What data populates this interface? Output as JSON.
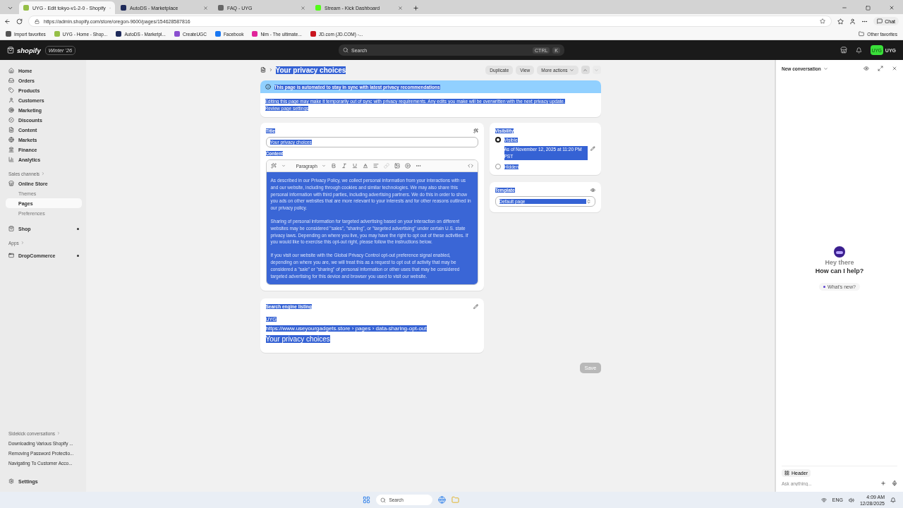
{
  "browser": {
    "tabs": [
      {
        "label": "UYG - Edit tokyo-v1-2-0 - Shopify",
        "selected": true,
        "color": "#95bf47"
      },
      {
        "label": "AutoDS - Marketplace",
        "selected": false,
        "color": "#1e2a5a"
      },
      {
        "label": "FAQ - UYG",
        "selected": false,
        "color": "#666666"
      },
      {
        "label": "Stream - Kick Dashboard",
        "selected": false,
        "color": "#53fc18"
      }
    ],
    "url": "https://admin.shopify.com/store/oregon-9600/pages/154628587816",
    "chat_button": "Chat",
    "bookmarks": [
      {
        "label": "Import favorites",
        "color": "#555555"
      },
      {
        "label": "UYG - Home - Shop...",
        "color": "#95bf47"
      },
      {
        "label": "AutoDS - Marketpl...",
        "color": "#1e2a5a"
      },
      {
        "label": "CreateUGC",
        "color": "#8a4fcf"
      },
      {
        "label": "Facebook",
        "color": "#1877f2"
      },
      {
        "label": "Nim - The ultimate...",
        "color": "#e0249a"
      },
      {
        "label": "JD.com (JD.COM) -...",
        "color": "#c9151e"
      }
    ],
    "other_favorites": "Other favorites"
  },
  "topbar": {
    "logo": "shopify",
    "edition": "Winter '26",
    "search_placeholder": "Search",
    "shortcut": [
      "CTRL",
      "K"
    ],
    "store_initials": "UYG",
    "store_name": "UYG"
  },
  "sidebar": {
    "items": [
      {
        "label": "Home",
        "selected": false
      },
      {
        "label": "Orders",
        "selected": false
      },
      {
        "label": "Products",
        "selected": false
      },
      {
        "label": "Customers",
        "selected": false
      },
      {
        "label": "Marketing",
        "selected": false
      },
      {
        "label": "Discounts",
        "selected": false
      },
      {
        "label": "Content",
        "selected": false
      },
      {
        "label": "Markets",
        "selected": false
      },
      {
        "label": "Finance",
        "selected": false
      },
      {
        "label": "Analytics",
        "selected": false
      }
    ],
    "sales_channels_label": "Sales channels",
    "channels": [
      {
        "label": "Online Store",
        "dot": false,
        "children": [
          {
            "label": "Themes",
            "selected": false
          },
          {
            "label": "Pages",
            "selected": true
          },
          {
            "label": "Preferences",
            "selected": false
          }
        ]
      },
      {
        "label": "Shop",
        "dot": true
      }
    ],
    "apps_label": "Apps",
    "apps": [
      {
        "label": "DropCommerce",
        "dot": true
      }
    ],
    "conversations_label": "Sidekick conversations",
    "conversations": [
      "Downloading Various Shopify ...",
      "Removing Password Protectio...",
      "Navigating To Customer Acco..."
    ],
    "settings": "Settings"
  },
  "page": {
    "text_selected": true,
    "title": "Your privacy choices",
    "actions": [
      "Duplicate",
      "View",
      "More actions"
    ],
    "nav": [
      {
        "disabled": false
      },
      {
        "disabled": true
      }
    ],
    "banner": {
      "title": "This page is automated to stay in sync with latest privacy recommendations",
      "body": "Editing this page may make it temporarily out of sync with privacy requirements. Any edits you make will be overwritten with the next privacy update.",
      "link": "Review page settings"
    },
    "title_field": {
      "label": "Title",
      "value": "Your privacy choices"
    },
    "content": {
      "label": "Content",
      "format": "Paragraph",
      "paragraphs": [
        "As described in our Privacy Policy, we collect personal information from your interactions with us and our website, including through cookies and similar technologies. We may also share this personal information with third parties, including advertising partners. We do this in order to show you ads on other websites that are more relevant to your interests and for other reasons outlined in our privacy policy.",
        "Sharing of personal information for targeted advertising based on your interaction on different websites may be considered \"sales\", \"sharing\", or \"targeted advertising\" under certain U.S. state privacy laws. Depending on where you live, you may have the right to opt out of these activities. If you would like to exercise this opt-out right, please follow the instructions below.",
        "If you visit our website with the Global Privacy Control opt-out preference signal enabled, depending on where you are, we will treat this as a request to opt out of activity that may be considered a \"sale\" or \"sharing\" of personal information or other uses that may be considered targeted advertising for this device and browser you used to visit our website."
      ]
    },
    "visibility": {
      "label": "Visibility",
      "options": [
        {
          "label": "Visible",
          "selected": true,
          "note": "As of November 12, 2025 at 11:20 PM PST"
        },
        {
          "label": "Hidden",
          "selected": false
        }
      ]
    },
    "template": {
      "label": "Template",
      "value": "Default page"
    },
    "seo": {
      "label": "Search engine listing",
      "site": "UYG",
      "url": "https://www.useyourgadgets.store › pages › data-sharing-opt-out",
      "title": "Your privacy choices"
    },
    "save": {
      "label": "Save",
      "disabled": true
    }
  },
  "sidekick": {
    "title": "New conversation",
    "greeting": "Hey there",
    "question": "How can I help?",
    "chip": "What's new?",
    "context_chip": "Header",
    "placeholder": "Ask anything..."
  },
  "taskbar": {
    "search": "Search",
    "language": "ENG",
    "time": "4:09 AM",
    "date": "12/28/2025"
  }
}
